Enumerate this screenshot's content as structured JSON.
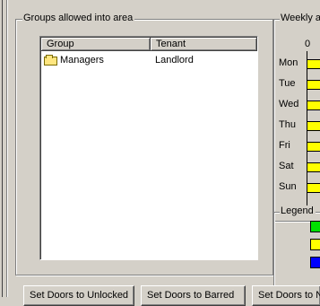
{
  "groups_box": {
    "title": "Groups allowed into area",
    "columns": [
      "Group",
      "Tenant"
    ],
    "rows": [
      {
        "group": "Managers",
        "tenant": "Landlord",
        "icon": "folder-icon"
      }
    ]
  },
  "schedule_box": {
    "title": "Weekly a",
    "hour_start": "0",
    "days": [
      "Mon",
      "Tue",
      "Wed",
      "Thu",
      "Fri",
      "Sat",
      "Sun"
    ],
    "bar_color": "#ffff00"
  },
  "legend_box": {
    "title": "Legend",
    "colors": [
      "#00e000",
      "#ffff00",
      "#0000ff"
    ]
  },
  "buttons": {
    "unlocked": "Set Doors to Unlocked",
    "barred": "Set Doors to Barred",
    "third": "Set Doors to N"
  }
}
